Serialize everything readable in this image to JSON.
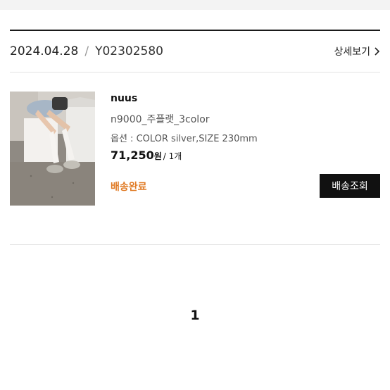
{
  "order": {
    "date": "2024.04.28",
    "separator": "/",
    "number": "Y02302580",
    "detail_label": "상세보기"
  },
  "item": {
    "brand": "nuus",
    "name": "n9000_주플랫_3color",
    "option": "옵션 : COLOR silver,SIZE 230mm",
    "price": "71,250",
    "currency": "원",
    "quantity": "/ 1개",
    "status": "배송완료",
    "track_label": "배송조회"
  },
  "pagination": {
    "current": "1"
  },
  "colors": {
    "status": "#e07a24",
    "button_bg": "#111111"
  }
}
